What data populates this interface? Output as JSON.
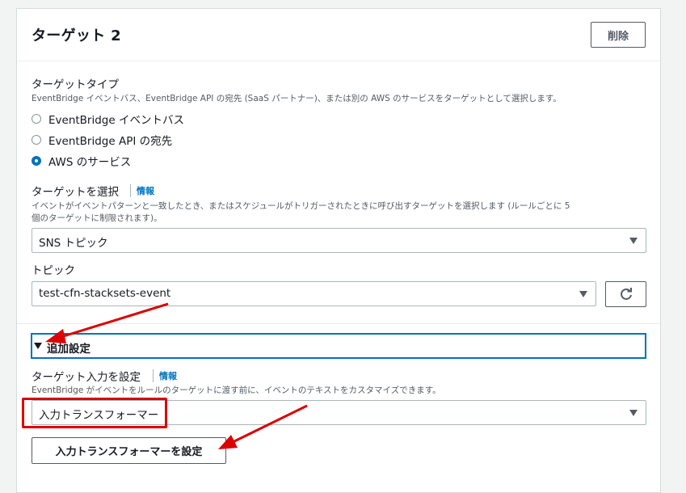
{
  "panel": {
    "title": "ターゲット 2",
    "delete_label": "削除"
  },
  "target_type": {
    "label": "ターゲットタイプ",
    "description": "EventBridge イベントバス、EventBridge API の宛先 (SaaS パートナー)、または別の AWS のサービスをターゲットとして選択します。",
    "options": [
      {
        "label": "EventBridge イベントバス",
        "selected": false
      },
      {
        "label": "EventBridge API の宛先",
        "selected": false
      },
      {
        "label": "AWS のサービス",
        "selected": true
      }
    ]
  },
  "select_target": {
    "label": "ターゲットを選択",
    "info": "情報",
    "description_line1": "イベントがイベントパターンと一致したとき、またはスケジュールがトリガーされたときに呼び出すターゲットを選択します (ルールごとに 5",
    "description_line2": "個のターゲットに制限されます)。",
    "value": "SNS トピック"
  },
  "topic": {
    "label": "トピック",
    "value": "test-cfn-stacksets-event"
  },
  "additional": {
    "label": "追加設定"
  },
  "target_input": {
    "label": "ターゲット入力を設定",
    "info": "情報",
    "description": "EventBridge がイベントをルールのターゲットに渡す前に、イベントのテキストをカスタマイズできます。",
    "value": "入力トランスフォーマー",
    "configure_label": "入力トランスフォーマーを設定"
  },
  "colors": {
    "accent": "#0073bb",
    "annotation": "#dd0000"
  }
}
